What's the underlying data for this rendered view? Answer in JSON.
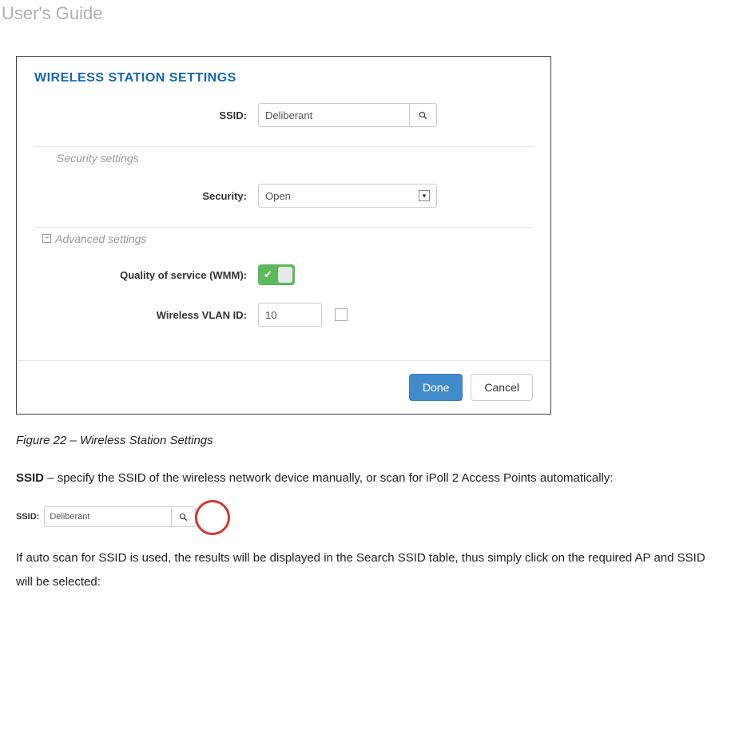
{
  "header": {
    "title": "User's Guide"
  },
  "panel": {
    "title": "WIRELESS STATION SETTINGS",
    "ssid_label": "SSID:",
    "ssid_value": "Deliberant",
    "security_section_title": "Security settings",
    "security_label": "Security:",
    "security_value": "Open",
    "advanced_section_title": "Advanced settings",
    "wmm_label": "Quality of service (WMM):",
    "vlan_label": "Wireless VLAN ID:",
    "vlan_value": "10",
    "done_label": "Done",
    "cancel_label": "Cancel"
  },
  "figure_caption": "Figure 22 – Wireless Station Settings",
  "para1_strong": "SSID",
  "para1_rest": " – specify the SSID of the wireless network device manually, or scan for iPoll 2 Access Points automatically:",
  "small_fig": {
    "label": "SSID:",
    "value": "Deliberant"
  },
  "para2": "If auto scan for SSID is used, the results will be displayed in the Search SSID table, thus simply click on the required AP and SSID will be selected:"
}
